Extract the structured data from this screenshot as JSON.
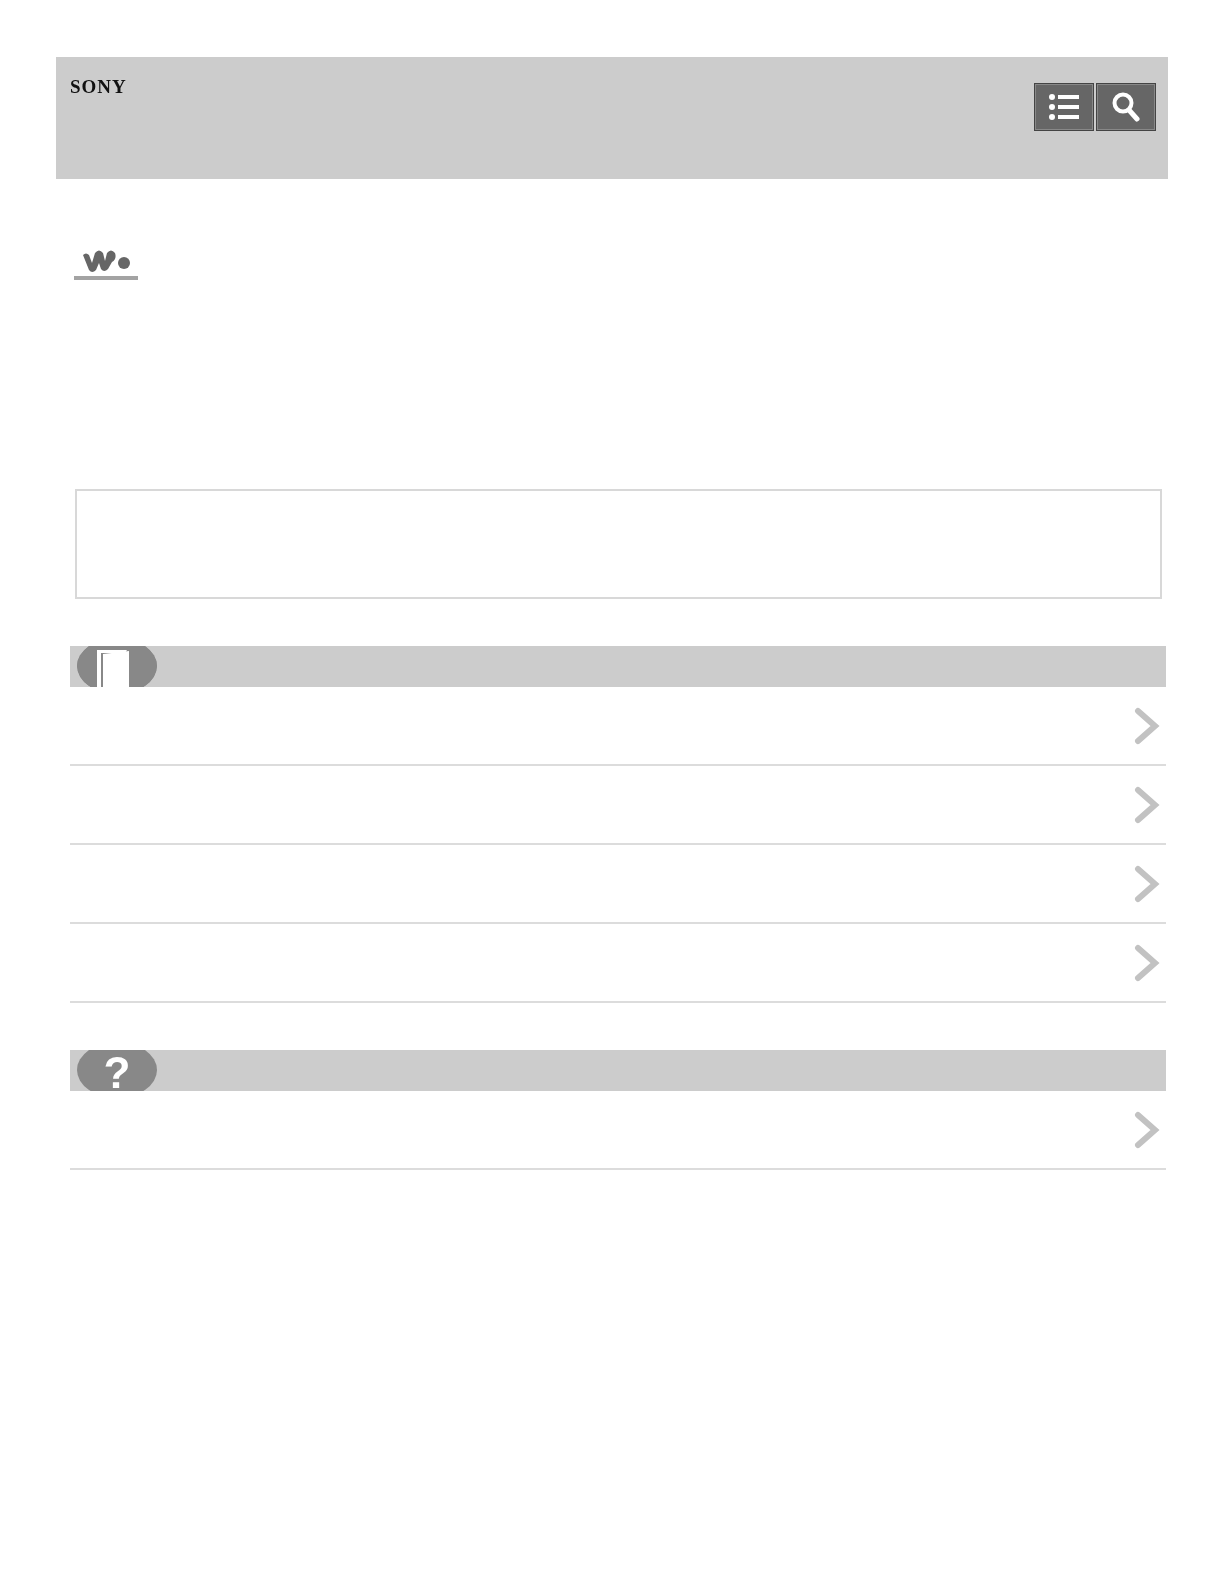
{
  "header": {
    "brand": "SONY",
    "buttons": [
      {
        "kind": "menu"
      },
      {
        "kind": "search"
      }
    ]
  },
  "sections": [
    {
      "kind": "book",
      "rows": [
        {
          "arrow": true
        },
        {
          "arrow": true
        },
        {
          "arrow": true
        },
        {
          "arrow": true
        }
      ]
    },
    {
      "kind": "help",
      "symbol": "?",
      "rows": [
        {
          "arrow": true
        }
      ]
    }
  ]
}
